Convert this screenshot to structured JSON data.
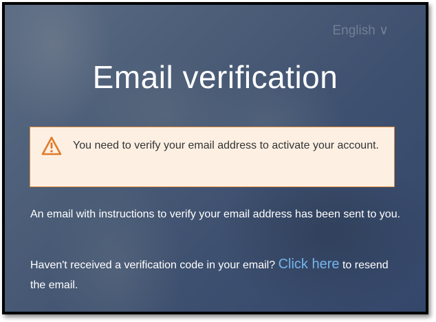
{
  "language_selector": {
    "label": "English ∨"
  },
  "page": {
    "title": "Email verification"
  },
  "alert": {
    "icon": "warning-icon",
    "icon_color": "#e07a2a",
    "message": "You need to verify your email address to activate your account."
  },
  "info": {
    "sent_message": "An email with instructions to verify your email address has been sent to you.",
    "resend_prefix": "Haven't received a verification code in your email? ",
    "resend_link": "Click here",
    "resend_suffix": " to resend the email."
  },
  "colors": {
    "title": "#ffffff",
    "alert_background": "#fdf0e3",
    "alert_border": "#e08a3e",
    "link": "#74b5ee"
  }
}
